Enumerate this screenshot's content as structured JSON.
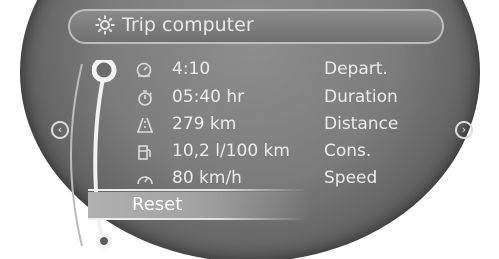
{
  "header": {
    "title": "Trip computer",
    "icon": "gear-icon"
  },
  "rows": [
    {
      "icon": "clock-dial-icon",
      "value": "4:10",
      "label": "Depart."
    },
    {
      "icon": "stopwatch-icon",
      "value": "05:40 hr",
      "label": "Duration"
    },
    {
      "icon": "road-distance-icon",
      "value": "279 km",
      "label": "Distance"
    },
    {
      "icon": "fuel-pump-icon",
      "value": "10,2 l/100 km",
      "label": "Cons."
    },
    {
      "icon": "speedometer-icon",
      "value": "80 km/h",
      "label": "Speed"
    }
  ],
  "reset": {
    "label": "Reset"
  },
  "nav": {
    "left": "‹",
    "right": "›"
  },
  "colors": {
    "display_bg": "#7c7c7c",
    "text": "#ececec",
    "highlight": "#a8a8a8"
  }
}
